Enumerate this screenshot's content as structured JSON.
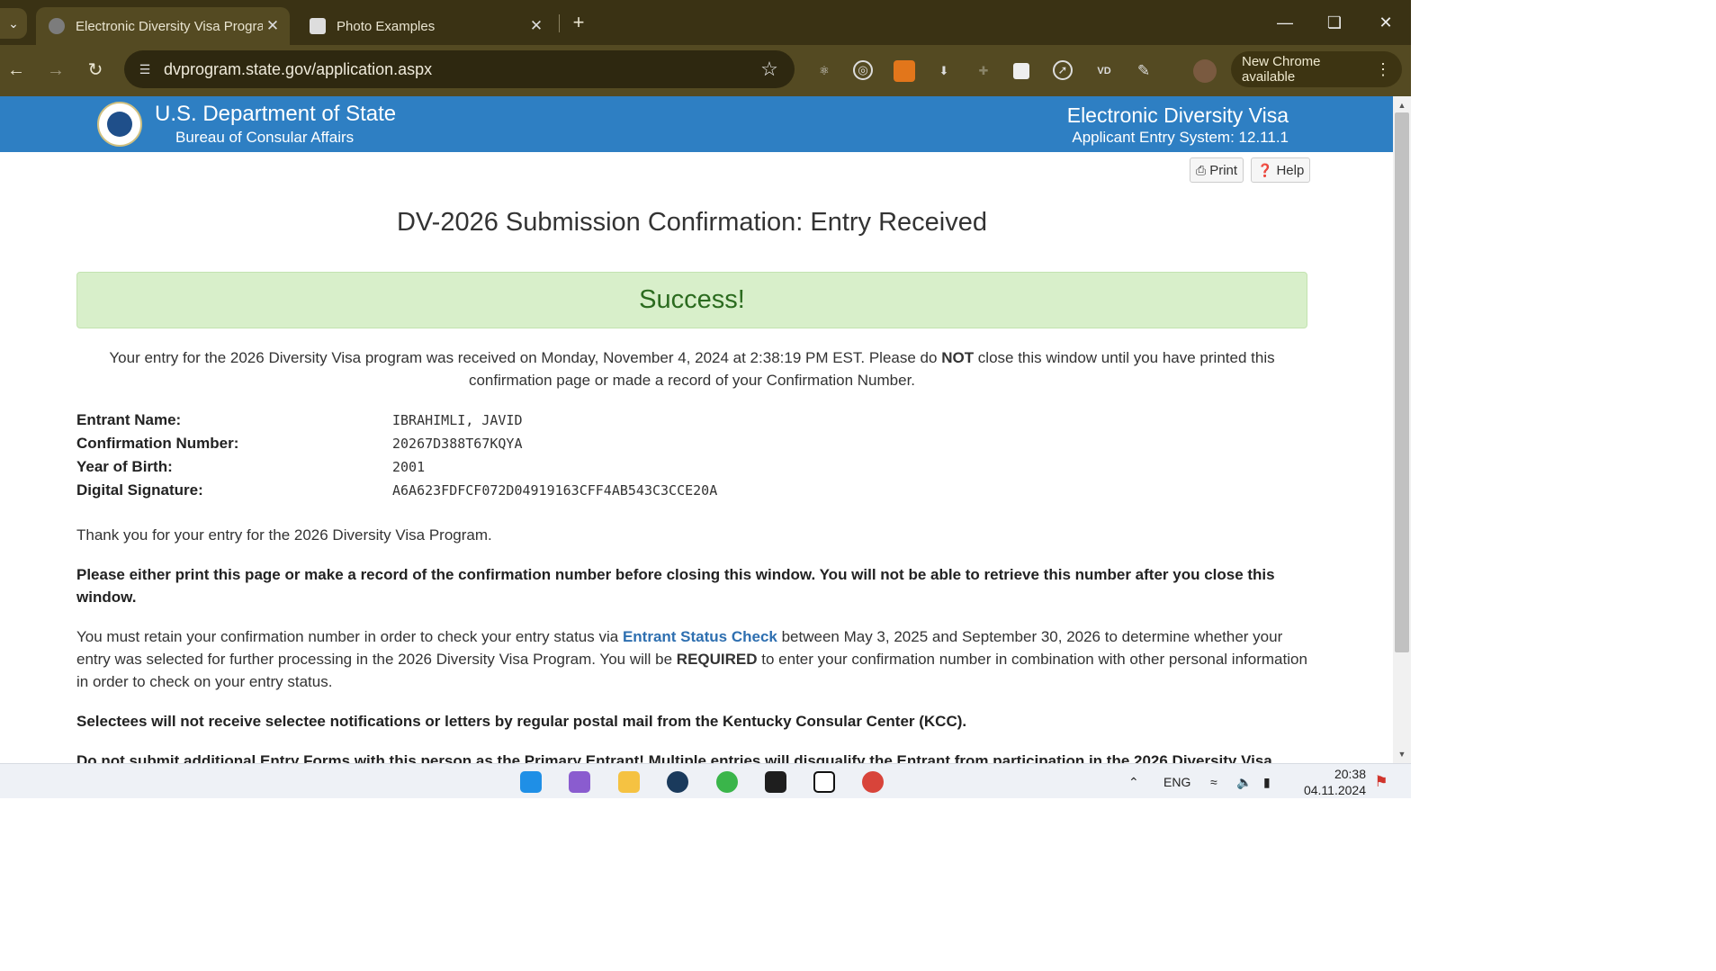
{
  "browser": {
    "tabs": [
      {
        "title": "Electronic Diversity Visa Program"
      },
      {
        "title": "Photo Examples"
      }
    ],
    "url": "dvprogram.state.gov/application.aspx",
    "update_label": "New Chrome available"
  },
  "header": {
    "dept": "U.S. Department of State",
    "bureau": "Bureau of Consular Affairs",
    "system_title": "Electronic Diversity Visa",
    "system_version": "Applicant Entry System: 12.11.1"
  },
  "actions": {
    "print": "Print",
    "help": "Help"
  },
  "page": {
    "title": "DV-2026 Submission Confirmation: Entry Received",
    "success": "Success!",
    "intro_1": "Your entry for the 2026 Diversity Visa program was received on Monday, November 4, 2024 at 2:38:19 PM EST. Please do ",
    "intro_not": "NOT",
    "intro_2": " close this window until you have printed this confirmation page or made a record of your Confirmation Number."
  },
  "fields": [
    {
      "label": "Entrant Name:",
      "value": "IBRAHIMLI, JAVID"
    },
    {
      "label": "Confirmation Number:",
      "value": "20267D388T67KQYA"
    },
    {
      "label": "Year of Birth:",
      "value": "2001"
    },
    {
      "label": "Digital Signature:",
      "value": "A6A623FDFCF072D04919163CFF4AB543C3CCE20A"
    }
  ],
  "body": {
    "thanks": "Thank you for your entry for the 2026 Diversity Visa Program.",
    "warning": "Please either print this page or make a record of the confirmation number before closing this window. You will not be able to retrieve this number after you close this window.",
    "retain_1": "You must retain your confirmation number in order to check your entry status via ",
    "retain_link": "Entrant Status Check",
    "retain_2": " between May 3, 2025 and September 30, 2026 to determine whether your entry was selected for further processing in the 2026 Diversity Visa Program. You will be ",
    "retain_required": "REQUIRED",
    "retain_3": " to enter your confirmation number in combination with other personal information in order to check on your entry status.",
    "selectees": "Selectees will not receive selectee notifications or letters by regular postal mail from the Kentucky Consular Center (KCC).",
    "multiple": "Do not submit additional Entry Forms with this person as the Primary Entrant! Multiple entries will disqualify the Entrant from participation in the 2026 Diversity Visa"
  },
  "taskbar": {
    "lang": "ENG",
    "time": "20:38",
    "date": "04.11.2024"
  }
}
